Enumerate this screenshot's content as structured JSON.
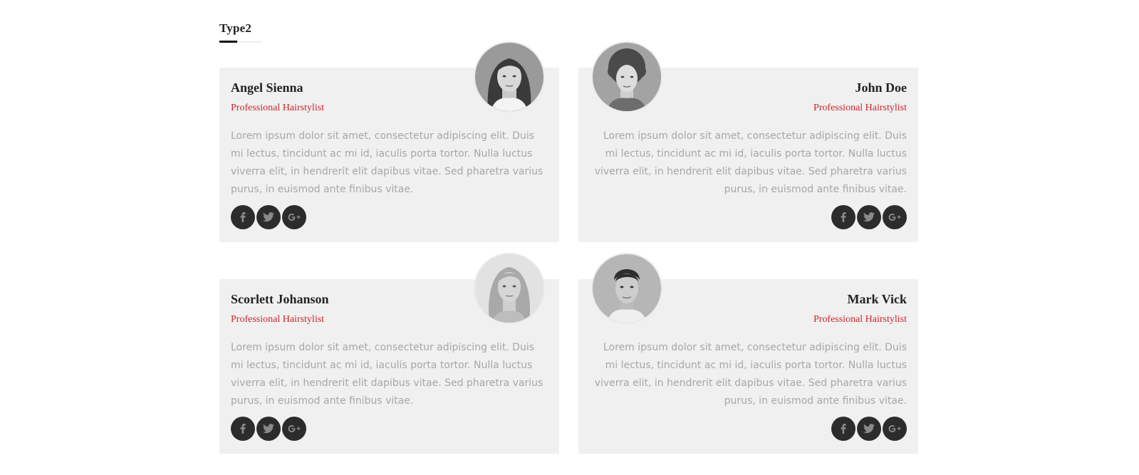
{
  "section": {
    "title": "Type2"
  },
  "members": [
    {
      "name": "Angel Sienna",
      "role": "Professional Hairstylist",
      "bio": "Lorem ipsum dolor sit amet, consectetur adipiscing elit. Duis mi lectus, tincidunt ac mi id, iaculis porta tortor. Nulla luctus viverra elit, in hendrerit elit dapibus vitae. Sed pharetra varius purus, in euismod ante finibus vitae.",
      "socials": [
        "facebook-icon",
        "twitter-icon",
        "google-plus-icon"
      ]
    },
    {
      "name": "John Doe",
      "role": "Professional Hairstylist",
      "bio": "Lorem ipsum dolor sit amet, consectetur adipiscing elit. Duis mi lectus, tincidunt ac mi id, iaculis porta tortor. Nulla luctus viverra elit, in hendrerit elit dapibus vitae. Sed pharetra varius purus, in euismod ante finibus vitae.",
      "socials": [
        "facebook-icon",
        "twitter-icon",
        "google-plus-icon"
      ]
    },
    {
      "name": "Scorlett Johanson",
      "role": "Professional Hairstylist",
      "bio": "Lorem ipsum dolor sit amet, consectetur adipiscing elit. Duis mi lectus, tincidunt ac mi id, iaculis porta tortor. Nulla luctus viverra elit, in hendrerit elit dapibus vitae. Sed pharetra varius purus, in euismod ante finibus vitae.",
      "socials": [
        "facebook-icon",
        "twitter-icon",
        "google-plus-icon"
      ]
    },
    {
      "name": "Mark Vick",
      "role": "Professional Hairstylist",
      "bio": "Lorem ipsum dolor sit amet, consectetur adipiscing elit. Duis mi lectus, tincidunt ac mi id, iaculis porta tortor. Nulla luctus viverra elit, in hendrerit elit dapibus vitae. Sed pharetra varius purus, in euismod ante finibus vitae.",
      "socials": [
        "facebook-icon",
        "twitter-icon",
        "google-plus-icon"
      ]
    }
  ],
  "colors": {
    "accent": "#d0242b",
    "card_background": "#f0f0f0",
    "social_background": "#2c2c2c",
    "bio_text": "#a7a7a7",
    "name_text": "#222222"
  }
}
